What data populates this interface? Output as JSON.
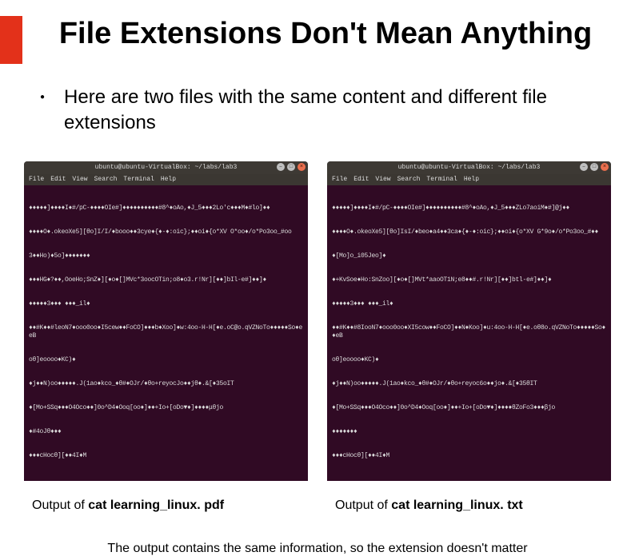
{
  "title": "File Extensions Don't Mean Anything",
  "bullet": "Here are two files with the same content and different file extensions",
  "terminals": {
    "titlebar": "ubuntu@ubuntu-VirtualBox: ~/labs/lab3",
    "menu": {
      "file": "File",
      "edit": "Edit",
      "view": "View",
      "search": "Search",
      "terminal": "Terminal",
      "help": "Help"
    },
    "window_buttons": {
      "min": "–",
      "max": "□",
      "close": "×"
    },
    "left_lines": [
      "♦♦♦♦♦]♦♦♦♦I♦#/pC-♦♦♦♦OIe#]♦♦♦♦♦♦♦♦♦♦#8^♦oAo,♦J_5♦♦♦2Lo'c♦♦♦M♦#lo]♦♦",
      "♦♦♦♦O♦.okeoXe5][θo]I/I/♦booo♦♦3cye♦{♦-♦:oic};♦♦oi♦{o*XV O*oo♦/o*Po3oo_#oo",
      "3♦♦Ho)♦5o]♦♦♦♦♦♦♦",
      "♦♦♦HG♦?♦♦,OoeHo;SnZ♦][♦o♦[]MVc*3oocOTin;o8♦o3.r!Nr][♦♦]bIl-e#]♦♦]♦",
      "♦♦♦♦♦3♦♦♦ ♦♦♦_il♦",
      "♦♦#K♦♦#leoN7♦ooo0oo♦I5cew♦♦FoCO]♦♦♦b♦Xoo]♦w:4oo-H-H[♦e.oC@o.qVZNoTo♦♦♦♦♦So♦eeB",
      "oθ]eoooo♦KC)♦",
      "♦j♦♦N)oo♦♦♦♦♦.J(1ao♦kco_♦θ#♦OJr/♦θo+reyocJo♦♦jθ♦.&[♦35oIT",
      "♦[Mo+SSq♦♦♦O4Oco♦♦]0o^D4♦Ooq[oo♦]♦♦+Io+[oDo▼♦]♦♦♦♦μθjo",
      "♦#4oJθ♦♦♦",
      "♦♦♦cHocθ][♦♦4I♦M"
    ],
    "right_lines": [
      "♦♦♦♦♦]♦♦♦♦I♦#/pC-♦♦♦♦OIe#]♦♦♦♦♦♦♦♦♦♦#8^♦oAo,♦J_5♦♦♦ZLo7aoiM♦#]@j♦♦",
      "♦♦♦♦O♦.okeoXe5][θo]IsI/♦beo♦a4♦♦3ca♦{♦-♦:oic};♦♦oi♦{o*XV G*9o♦/o*Po3oo_#♦♦",
      "♦[Mo]o_i05Jeo]♦",
      "♦+KvSoe♦Ho:SnZoo][♦o♦[]MVt*aaoOT1N;e8♦♦#.r!Nr][♦♦]btl-e#]♦♦]♦",
      "♦♦♦♦♦3♦♦♦ ♦♦♦_il♦",
      "♦♦#K♦♦#8IooN7♦ooo0oo♦XI5cow♦♦FoCO]♦♦N♦Koo]♦u:4oo-H-H[♦e.oθ8o.qVZNoTo♦♦♦♦♦So♦♦eB",
      "oθ]eoooo♦KC)♦",
      "♦j♦♦N)oo♦♦♦♦♦.J(1ao♦kco_♦θ#♦OJr/♦θo+reyoc6o♦♦jo♦.&[♦35θIT",
      "♦[Mo+SSq♦♦♦O4Oco♦♦]0o^D4♦Ooq[oo♦]♦♦+Io+[oDo▼♦]♦♦♦♦θZoFo3♦♦♦βjo",
      "♦♦♦♦♦♦♦",
      "♦♦♦cHocθ][♦♦4I♦M"
    ]
  },
  "caption_left_prefix": "Output of ",
  "caption_left_bold": "cat learning_linux. pdf",
  "caption_right_prefix": "Output of ",
  "caption_right_bold": "cat learning_linux. txt",
  "footer": "The output contains the same information, so the extension doesn't matter"
}
